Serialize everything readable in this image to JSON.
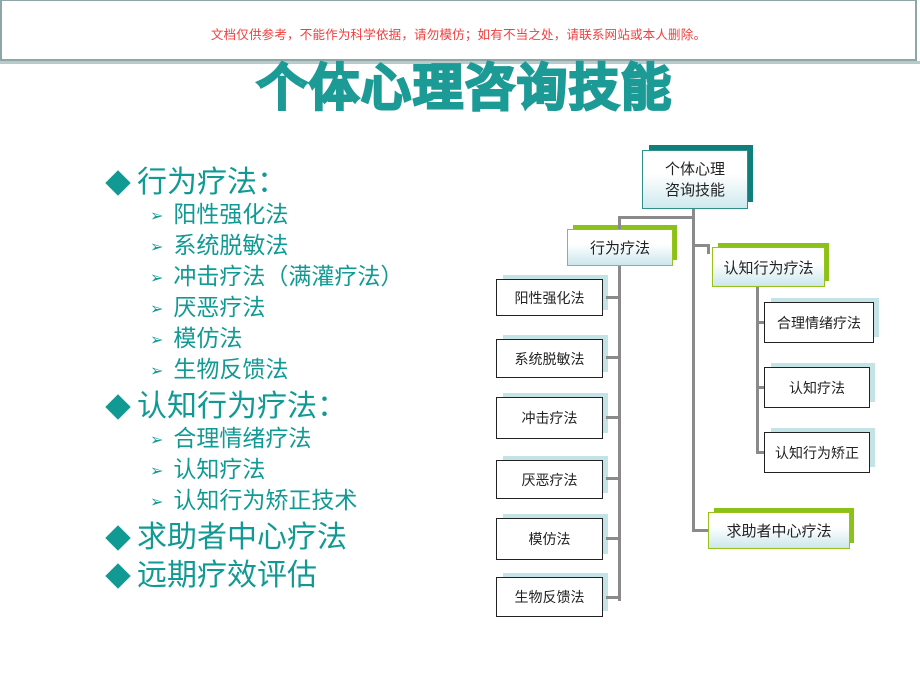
{
  "banner": {
    "notice": "文档仅供参考，不能作为科学依据，请勿模仿；如有不当之处，请联系网站或本人删除。",
    "notice_color": "#f04040"
  },
  "title": "个体心理咨询技能",
  "accent_color": "#119a94",
  "outline": [
    {
      "label": "行为疗法：",
      "children": [
        "阳性强化法",
        "系统脱敏法",
        "冲击疗法（满灌疗法）",
        "厌恶疗法",
        "模仿法",
        "生物反馈法"
      ]
    },
    {
      "label": "认知行为疗法：",
      "children": [
        "合理情绪疗法",
        "认知疗法",
        "认知行为矫正技术"
      ]
    },
    {
      "label": "求助者中心疗法",
      "children": []
    },
    {
      "label": "远期疗效评估",
      "children": []
    }
  ],
  "icons": {
    "bullet_l1": "diamond-icon",
    "bullet_l2": "arrowhead-icon",
    "bullet_l1_glyph": "◆",
    "bullet_l2_glyph": "➢"
  },
  "diagram": {
    "root": {
      "line1": "个体心理",
      "line2": "咨询技能"
    },
    "behavior": {
      "label": "行为疗法",
      "children": [
        "阳性强化法",
        "系统脱敏法",
        "冲击疗法",
        "厌恶疗法",
        "模仿法",
        "生物反馈法"
      ]
    },
    "cognitive": {
      "label": "认知行为疗法",
      "children": [
        "合理情绪疗法",
        "认知疗法",
        "认知行为矫正"
      ]
    },
    "client_centered": {
      "label": "求助者中心疗法"
    }
  }
}
